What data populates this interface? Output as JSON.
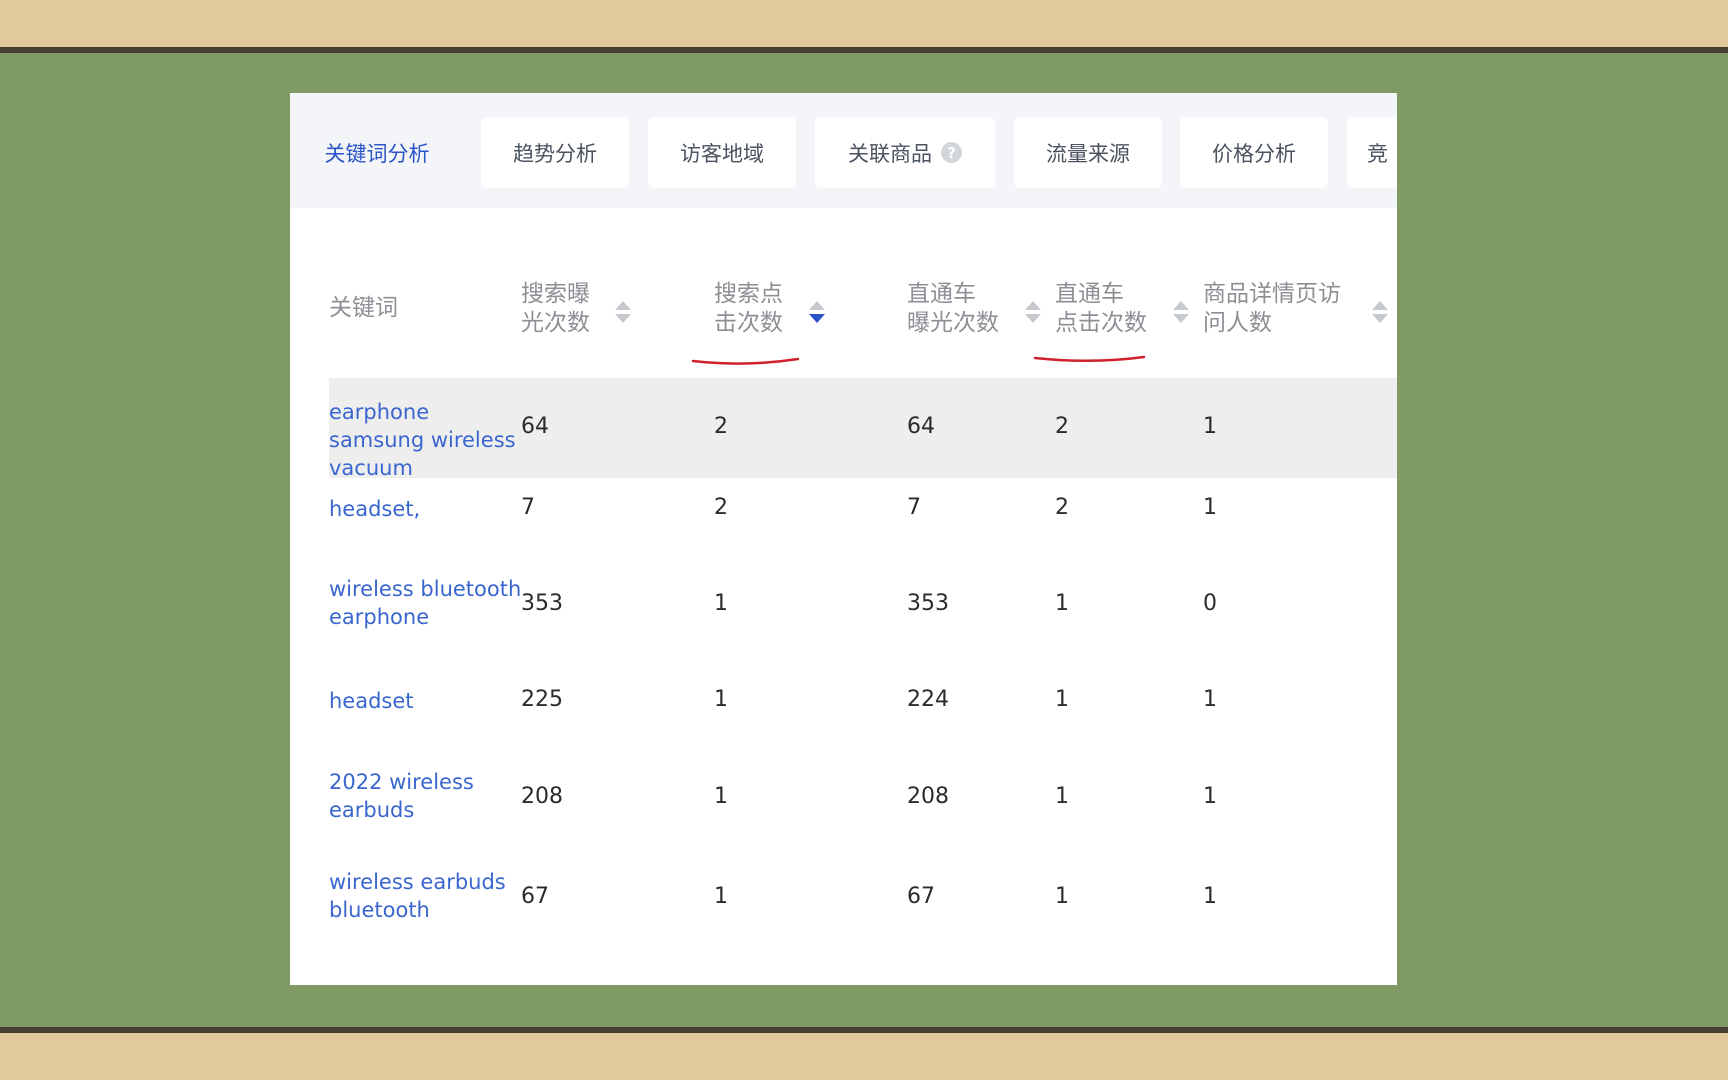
{
  "tabs": [
    {
      "label": "关键词分析",
      "active": true
    },
    {
      "label": "趋势分析"
    },
    {
      "label": "访客地域"
    },
    {
      "label": "关联商品",
      "has_help": true
    },
    {
      "label": "流量来源"
    },
    {
      "label": "价格分析"
    },
    {
      "label": "竞"
    }
  ],
  "help_glyph": "?",
  "columns": [
    {
      "line1": "关键词",
      "line2": ""
    },
    {
      "line1": "搜索曝",
      "line2": "光次数",
      "sort": "none"
    },
    {
      "line1": "搜索点",
      "line2": "击次数",
      "sort": "desc",
      "annotated": true
    },
    {
      "line1": "直通车",
      "line2": "曝光次数",
      "sort": "none"
    },
    {
      "line1": "直通车",
      "line2": "点击次数",
      "sort": "none",
      "annotated": true
    },
    {
      "line1": "商品详情页访",
      "line2": "问人数",
      "sort": "none"
    }
  ],
  "rows": [
    {
      "keyword": "earphone samsung wireless vacuum",
      "search_impr": "64",
      "search_clicks": "2",
      "ztc_impr": "64",
      "ztc_clicks": "2",
      "detail_visitors": "1",
      "highlighted": true
    },
    {
      "keyword": "headset,",
      "search_impr": "7",
      "search_clicks": "2",
      "ztc_impr": "7",
      "ztc_clicks": "2",
      "detail_visitors": "1"
    },
    {
      "keyword": "wireless bluetooth earphone",
      "search_impr": "353",
      "search_clicks": "1",
      "ztc_impr": "353",
      "ztc_clicks": "1",
      "detail_visitors": "0"
    },
    {
      "keyword": "headset",
      "search_impr": "225",
      "search_clicks": "1",
      "ztc_impr": "224",
      "ztc_clicks": "1",
      "detail_visitors": "1"
    },
    {
      "keyword": "2022 wireless earbuds",
      "search_impr": "208",
      "search_clicks": "1",
      "ztc_impr": "208",
      "ztc_clicks": "1",
      "detail_visitors": "1"
    },
    {
      "keyword": "wireless earbuds bluetooth",
      "search_impr": "67",
      "search_clicks": "1",
      "ztc_impr": "67",
      "ztc_clicks": "1",
      "detail_visitors": "1"
    }
  ],
  "colors": {
    "background": "#7f9a63",
    "band": "#e0c99b",
    "accent": "#2b54c9",
    "keyword_link": "#3a66cf",
    "annotation": "#d0202a",
    "highlight_row": "#eeeeee"
  }
}
